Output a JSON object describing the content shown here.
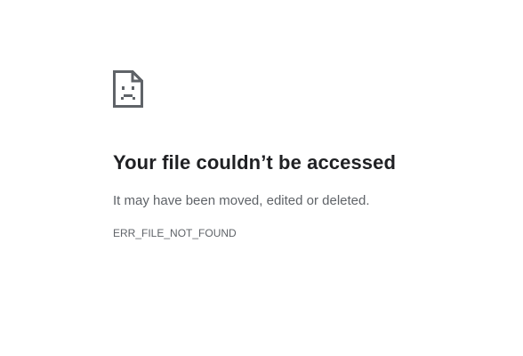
{
  "error_page": {
    "icon": "sad-file-icon",
    "title": "Your file couldn’t be accessed",
    "message": "It may have been moved, edited or deleted.",
    "error_code": "ERR_FILE_NOT_FOUND"
  }
}
